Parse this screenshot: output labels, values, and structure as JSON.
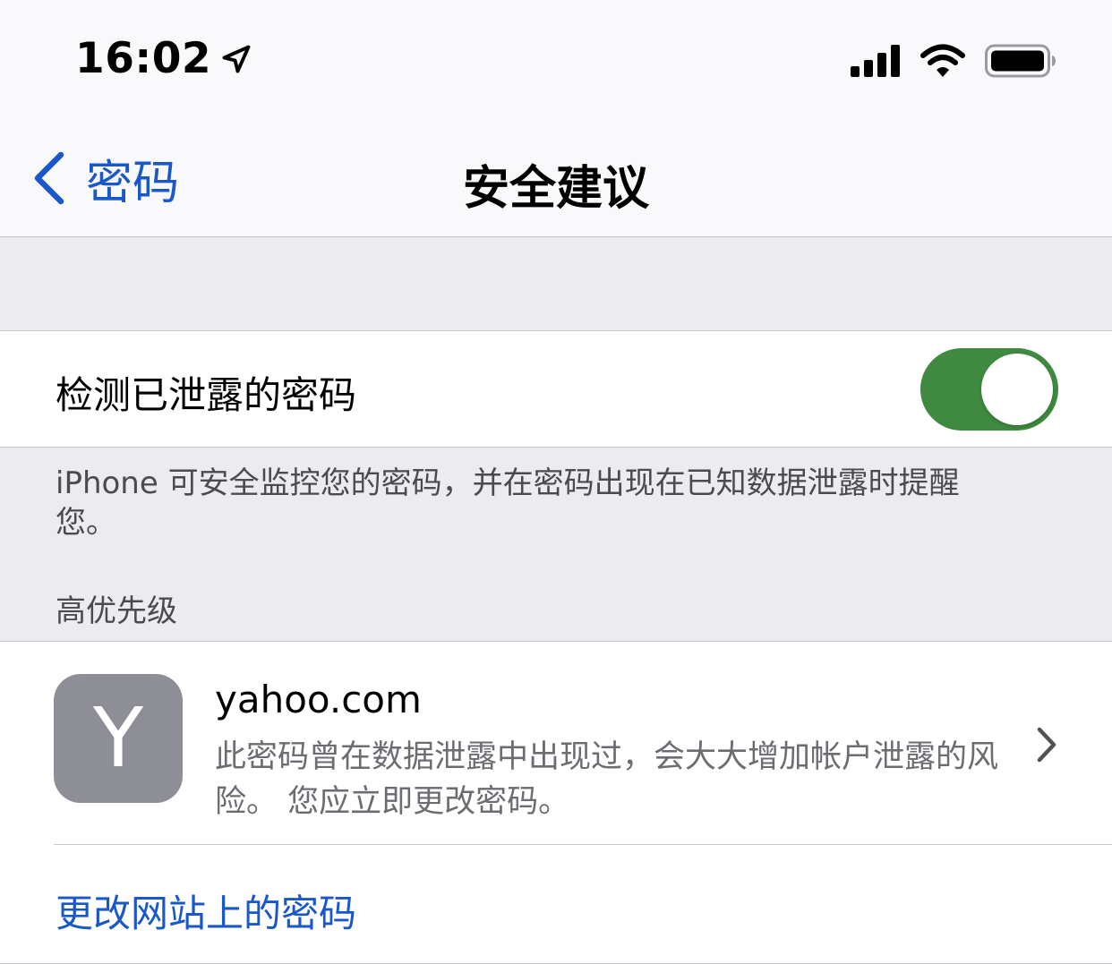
{
  "status_bar": {
    "time": "16:02",
    "icons": [
      "location-arrow-icon",
      "cellular-signal-icon",
      "wifi-icon",
      "battery-icon"
    ]
  },
  "nav": {
    "back_label": "密码",
    "title": "安全建议"
  },
  "settings": {
    "detect_label": "检测已泄露的密码",
    "detect_enabled": true,
    "footer": "iPhone 可安全监控您的密码，并在密码出现在已知数据泄露时提醒您。"
  },
  "section": {
    "header": "高优先级"
  },
  "item": {
    "avatar_letter": "Y",
    "title": "yahoo.com",
    "description": "此密码曾在数据泄露中出现过，会大大增加帐户泄露的风险。 您应立即更改密码。"
  },
  "action": {
    "label": "更改网站上的密码"
  },
  "colors": {
    "accent": "#1a57c9",
    "switch_on": "#3f8a40",
    "avatar_bg": "#8e8e96",
    "grouped_bg": "#ebebf0"
  }
}
